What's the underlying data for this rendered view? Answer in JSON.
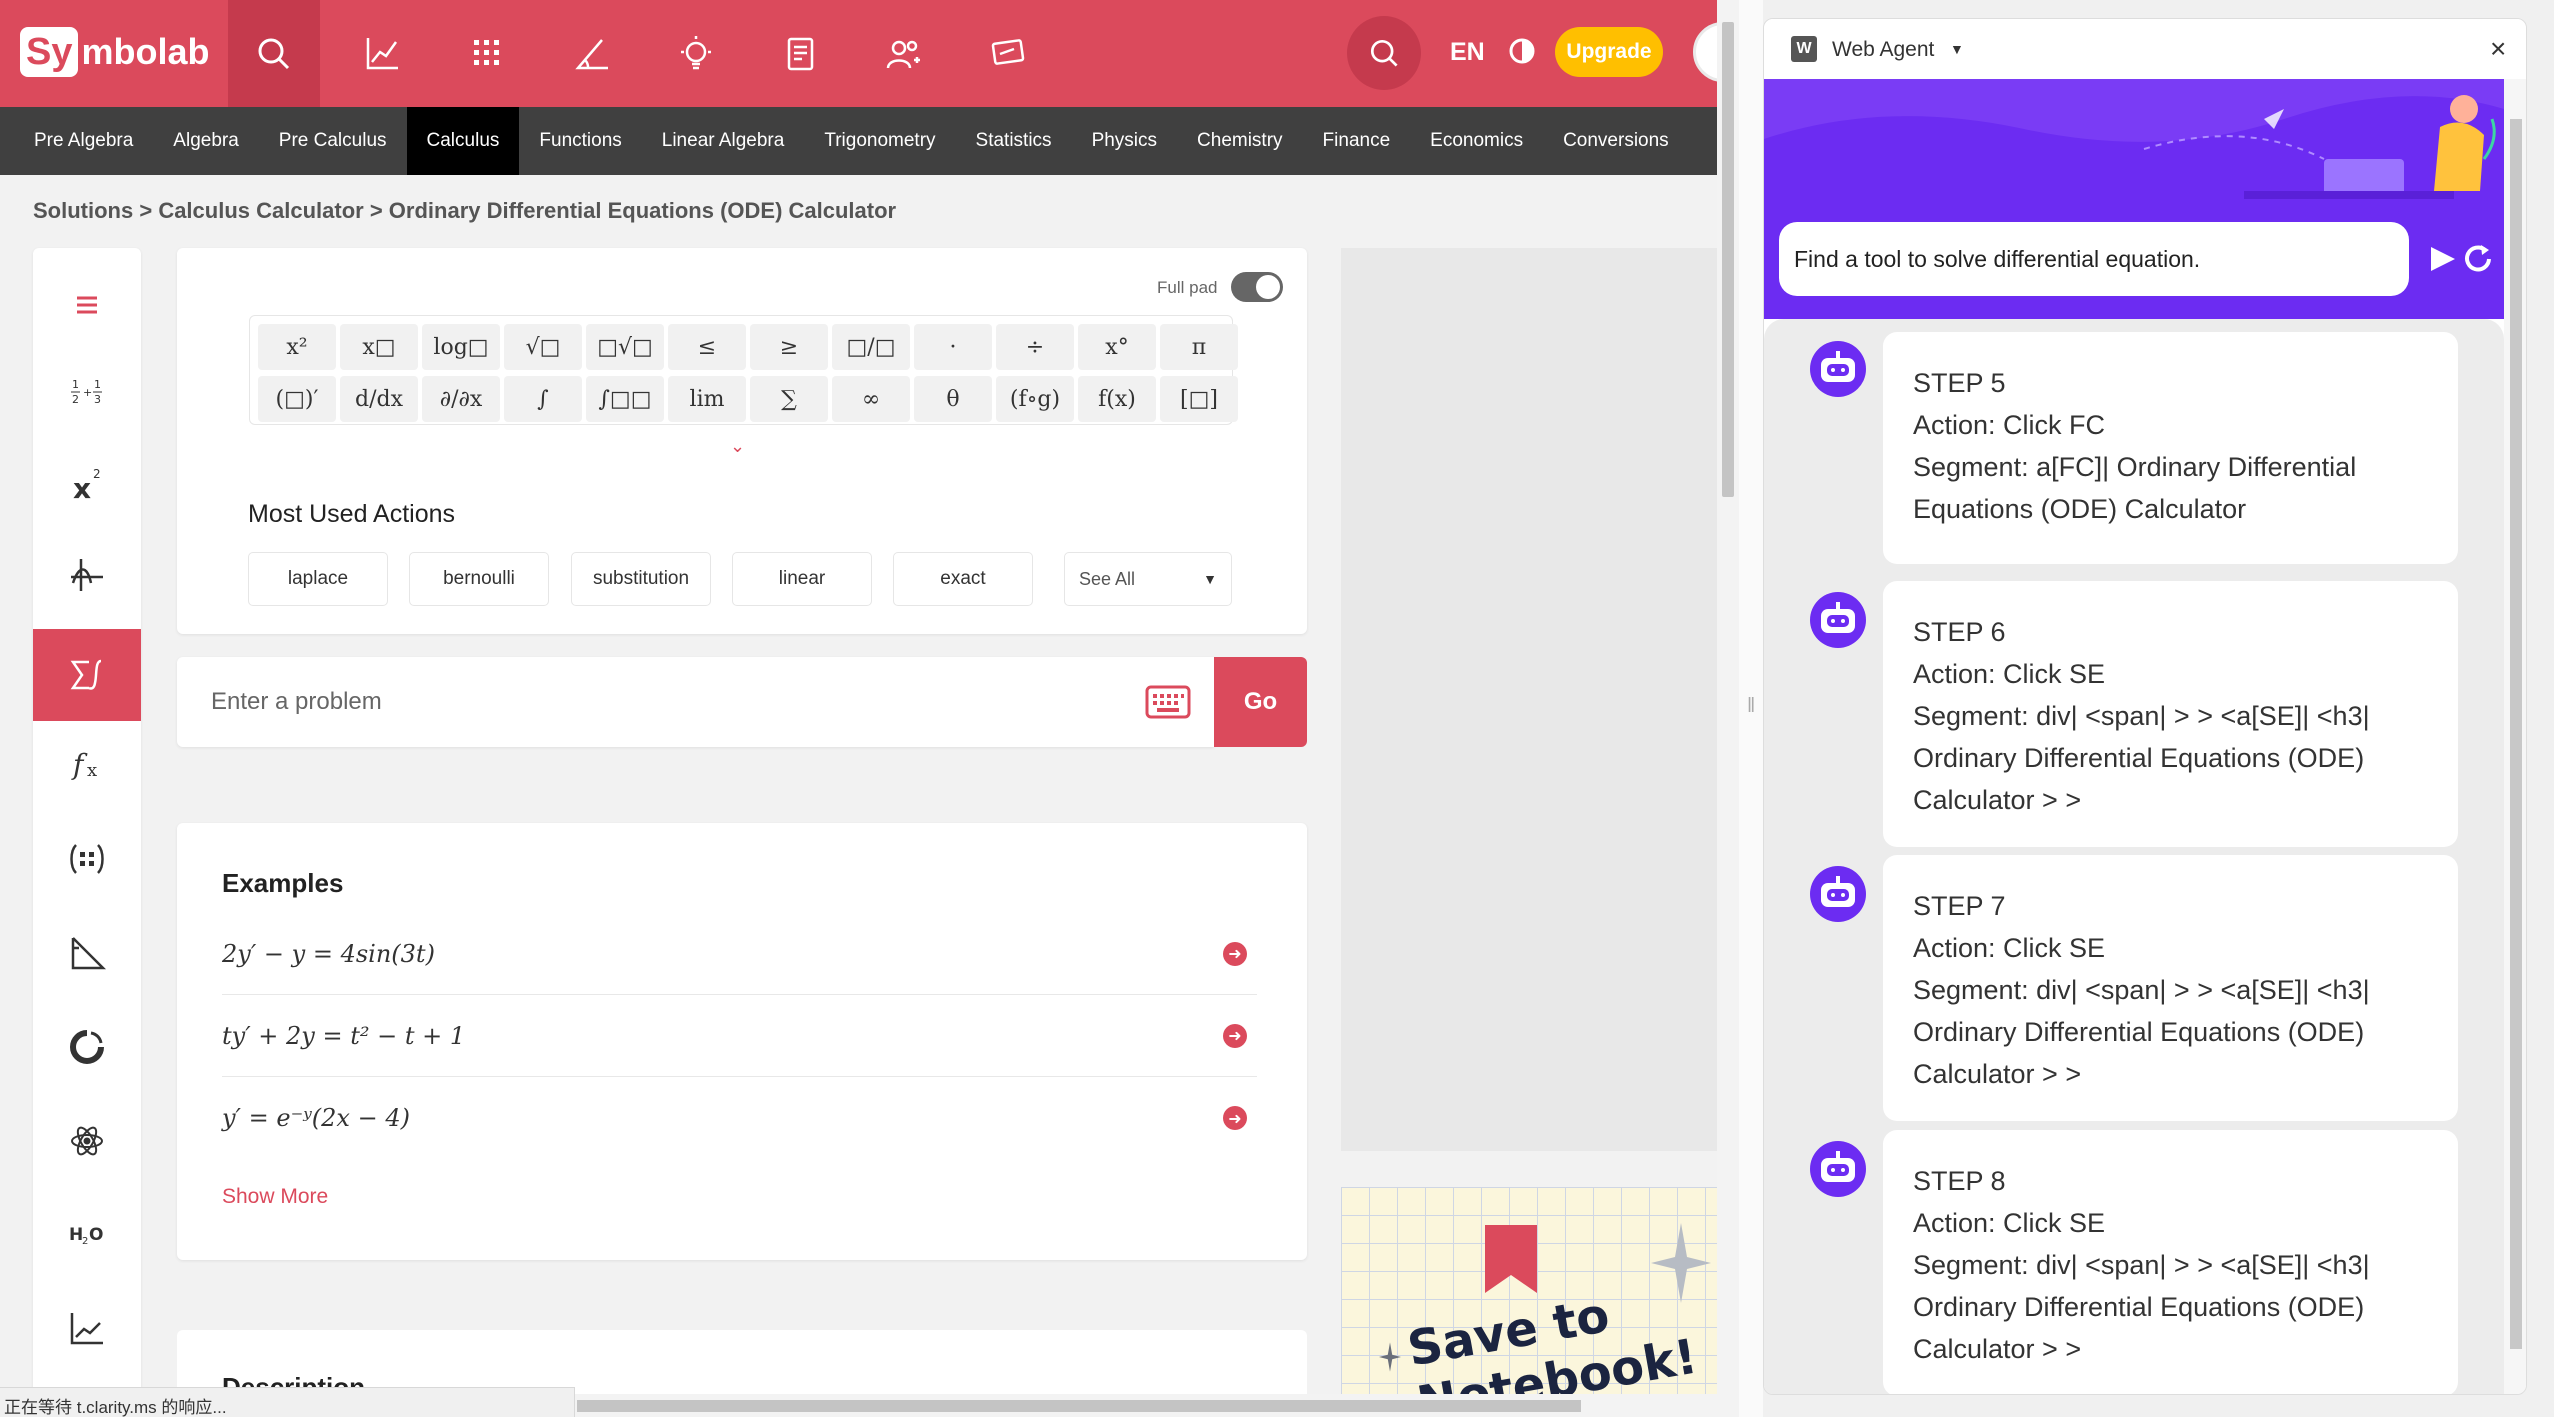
{
  "site": {
    "logo": {
      "box": "Sy",
      "rest": "mbolab"
    },
    "top_icons": [
      "search-icon",
      "graph-icon",
      "calculator-icon",
      "geometry-icon",
      "lightbulb-icon",
      "notebook-icon",
      "users-icon",
      "chalkboard-icon"
    ],
    "language": "EN",
    "upgrade_label": "Upgrade",
    "subnav": [
      "Pre Algebra",
      "Algebra",
      "Pre Calculus",
      "Calculus",
      "Functions",
      "Linear Algebra",
      "Trigonometry",
      "Statistics",
      "Physics",
      "Chemistry",
      "Finance",
      "Economics",
      "Conversions"
    ],
    "subnav_active": "Calculus",
    "breadcrumb": [
      "Solutions",
      "Calculus Calculator",
      "Ordinary Differential Equations (ODE) Calculator"
    ],
    "rail": [
      "menu-icon",
      "fractions-icon",
      "power-icon",
      "integral-limits-icon",
      "sigma-calculus-icon",
      "function-icon",
      "matrix-icon",
      "triangle-icon",
      "chart-icon",
      "atom-icon",
      "chemistry-icon",
      "line-chart-icon"
    ],
    "keypad": {
      "full_pad_label": "Full pad",
      "row1": [
        "x²",
        "x□",
        "log□",
        "√□",
        "□√□",
        "≤",
        "≥",
        "□/□",
        "·",
        "÷",
        "x°",
        "π"
      ],
      "row2": [
        "(□)′",
        "d/dx",
        "∂/∂x",
        "∫",
        "∫□□",
        "lim",
        "∑",
        "∞",
        "θ",
        "(f∘g)",
        "f(x)",
        "[□]"
      ]
    },
    "most_used": {
      "title": "Most Used Actions",
      "actions": [
        "laplace",
        "bernoulli",
        "substitution",
        "linear",
        "exact"
      ],
      "see_all": "See All"
    },
    "problem": {
      "placeholder": "Enter a problem",
      "go_label": "Go"
    },
    "examples": {
      "title": "Examples",
      "items": [
        "2y′ − y = 4sin(3t)",
        "ty′ + 2y = t² − t + 1",
        "y′ = e⁻ʸ(2x − 4)"
      ],
      "show_more": "Show More"
    },
    "description_title": "Description",
    "ad_text_line1": "Save to",
    "ad_text_line2": "Notebook!",
    "status_text": "正在等待 t.clarity.ms 的响应..."
  },
  "agent": {
    "title": "Web Agent",
    "query": "Find a tool to solve differential equation.",
    "steps": [
      {
        "step": "STEP 5",
        "action": "Action: Click FC",
        "segment": "Segment: a[FC]| Ordinary Differential Equations (ODE) Calculator"
      },
      {
        "step": "STEP 6",
        "action": "Action: Click SE",
        "segment": "Segment: div| <span| > > <a[SE]| <h3| Ordinary Differential Equations (ODE) Calculator > >"
      },
      {
        "step": "STEP 7",
        "action": "Action: Click SE",
        "segment": "Segment: div| <span| > > <a[SE]| <h3| Ordinary Differential Equations (ODE) Calculator > >"
      },
      {
        "step": "STEP 8",
        "action": "Action: Click SE",
        "segment": "Segment: div| <span| > > <a[SE]| <h3| Ordinary Differential Equations (ODE) Calculator > >"
      }
    ]
  },
  "colors": {
    "brand": "#db4a5c",
    "subnav": "#404040",
    "agent_banner": "#6c2cf2",
    "upgrade": "#ffbf00"
  }
}
